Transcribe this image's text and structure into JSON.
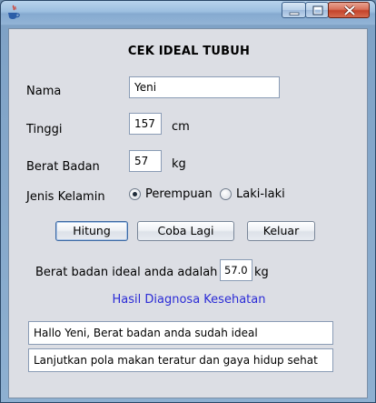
{
  "window": {
    "title": "",
    "titlebar_color": "#92b4d6",
    "close_color": "#c4432a"
  },
  "form": {
    "heading": "CEK IDEAL TUBUH",
    "nama_label": "Nama",
    "nama_value": "Yeni",
    "tinggi_label": "Tinggi",
    "tinggi_value": "157",
    "tinggi_unit": "cm",
    "berat_label": "Berat Badan",
    "berat_value": "57",
    "berat_unit": "kg",
    "gender_label": "Jenis Kelamin",
    "gender_options": [
      {
        "label": "Perempuan",
        "selected": true
      },
      {
        "label": "Laki-laki",
        "selected": false
      }
    ]
  },
  "buttons": {
    "hitung": "Hitung",
    "coba_lagi": "Coba Lagi",
    "keluar": "Keluar"
  },
  "result": {
    "ideal_label": "Berat badan ideal anda adalah",
    "ideal_value": "57.0",
    "ideal_unit": "kg",
    "diagnosis_heading": "Hasil Diagnosa Kesehatan",
    "diagnosis_heading_color": "#2b2bd6",
    "message1": "Hallo Yeni, Berat badan anda sudah ideal",
    "message2": "Lanjutkan pola makan teratur dan gaya hidup sehat"
  }
}
